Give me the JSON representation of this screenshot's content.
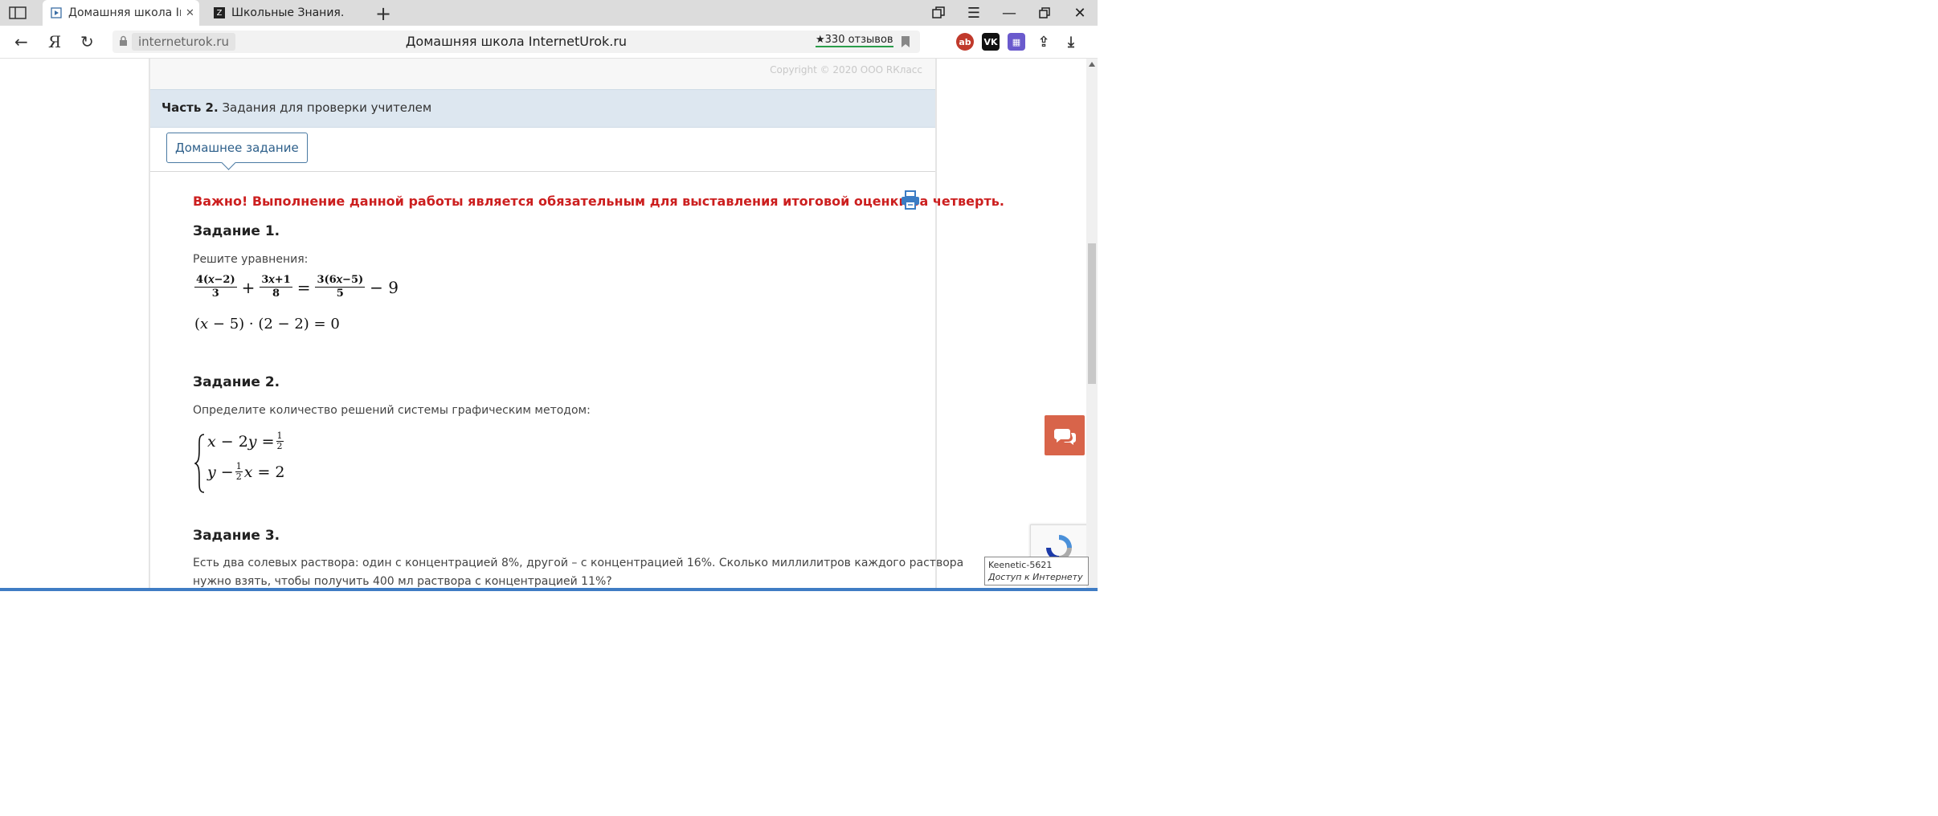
{
  "browser": {
    "tabs": [
      {
        "title": "Домашняя школа Intern",
        "active": true
      },
      {
        "title": "Школьные Знания.com - Р",
        "active": false
      }
    ],
    "address": {
      "host": "interneturok.ru",
      "page_title": "Домашняя школа InternetUrok.ru",
      "reviews": "★330 отзывов"
    }
  },
  "page": {
    "copyright": "Copyright © 2020 ООО RКласс",
    "part_label_bold": "Часть 2.",
    "part_label_rest": " Задания для проверки учителем",
    "homework_tab": "Домашнее задание",
    "important": "Важно! Выполнение данной работы является обязательным для выставления итоговой оценки за четверть.",
    "task1": {
      "heading": "Задание 1.",
      "instruction": "Решите уравнения:"
    },
    "task2": {
      "heading": "Задание 2.",
      "instruction": "Определите количество решений системы графическим методом:"
    },
    "task3": {
      "heading": "Задание 3.",
      "text_line1": "Есть два солевых раствора: один с концентрацией 8%, другой – с концентрацией 16%. Сколько миллилитров каждого раствора",
      "text_line2": "нужно взять, чтобы получить 400 мл раствора с концентрацией 11%?"
    }
  },
  "tooltip": {
    "line1": "Keenetic-5621",
    "line2": "Доступ к Интернету"
  },
  "colors": {
    "important_red": "#cc1f1f",
    "part_bar_bg": "#dde7f0",
    "chat_button": "#d8644a"
  }
}
